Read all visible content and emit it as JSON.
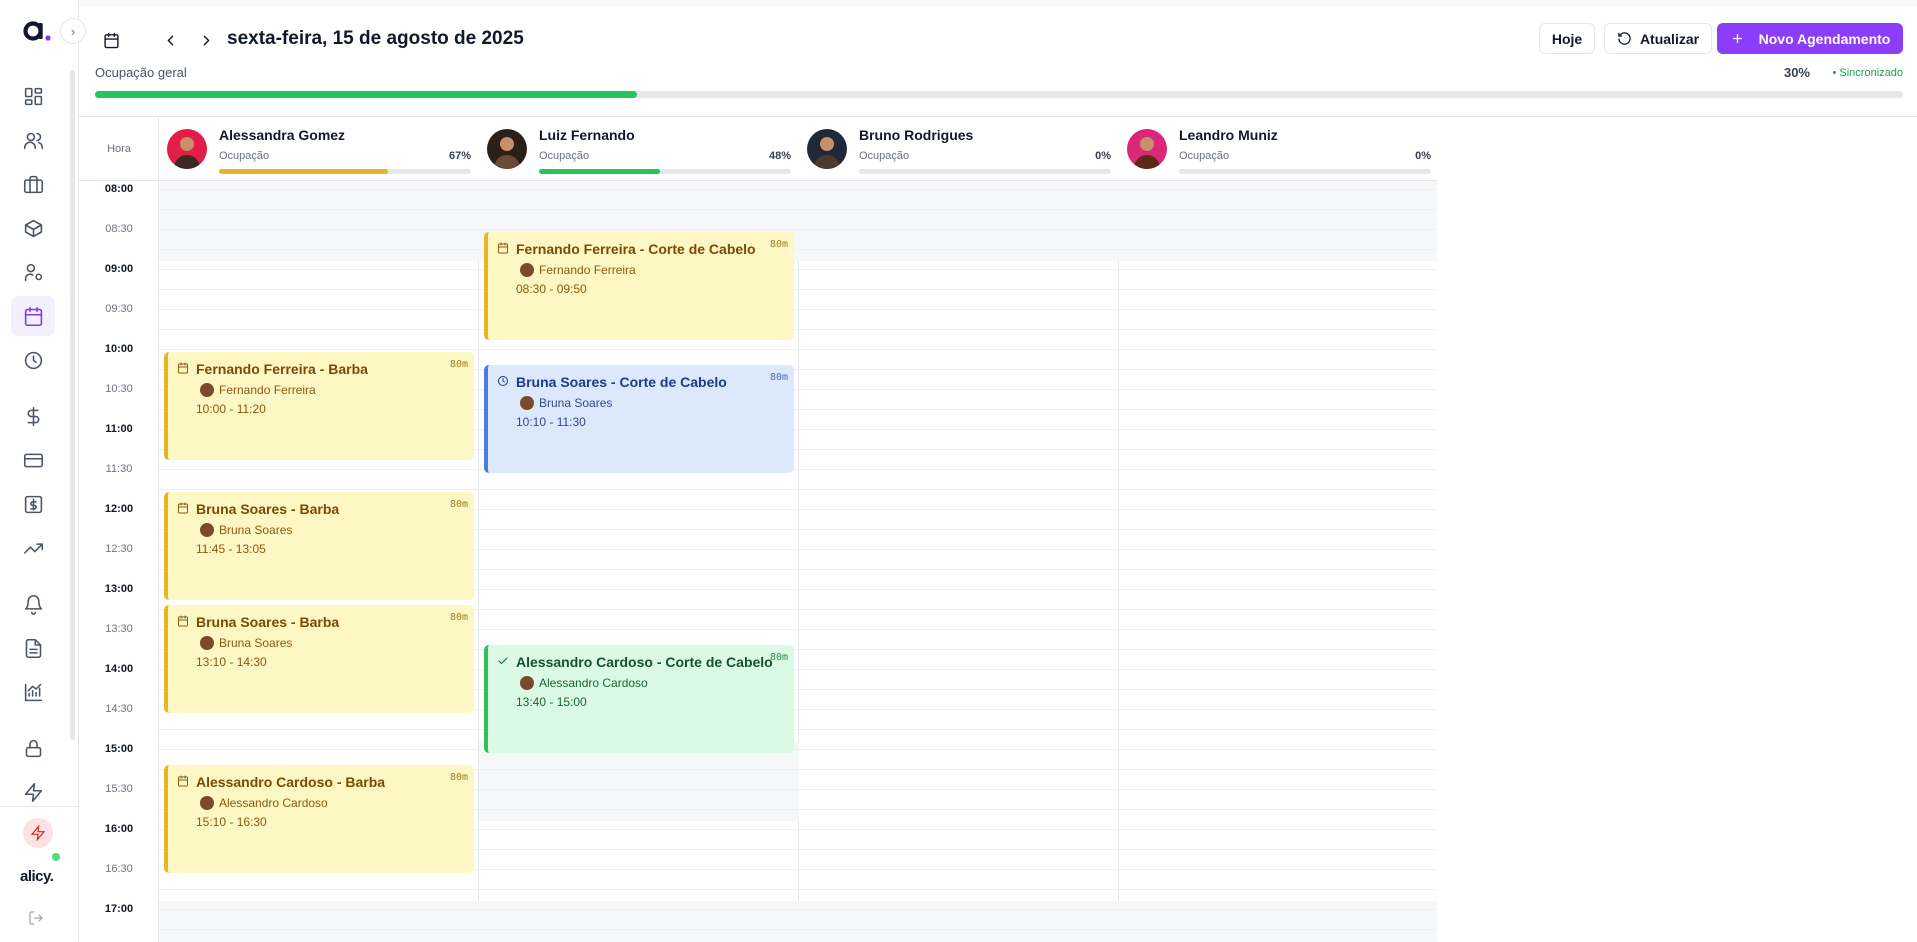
{
  "sidebar": {
    "brand_word": "alicy.",
    "nav_icons": [
      "dashboard-icon",
      "users-icon",
      "briefcase-icon",
      "package-icon",
      "user-cog-icon",
      "calendar-icon",
      "clock-icon",
      "dollar-icon",
      "credit-card-icon",
      "money-bill-icon",
      "trending-up-icon",
      "bell-icon",
      "document-icon",
      "chart-icon",
      "lock-icon",
      "bolt-icon"
    ],
    "active_item": "calendar-icon"
  },
  "header": {
    "date_title": "sexta-feira, 15 de agosto de 2025",
    "today_label": "Hoje",
    "refresh_label": "Atualizar",
    "new_label": "Novo Agendamento",
    "occupancy_label": "Ocupação geral",
    "occupancy_pct": "30%",
    "occupancy_value": 30,
    "sync_label": "• Sincronizado"
  },
  "grid": {
    "hora_label": "Hora",
    "times": [
      "08:00",
      "08:30",
      "09:00",
      "09:30",
      "10:00",
      "10:30",
      "11:00",
      "11:30",
      "12:00",
      "12:30",
      "13:00",
      "13:30",
      "14:00",
      "14:30",
      "15:00",
      "15:30",
      "16:00",
      "16:30",
      "17:00"
    ],
    "professionals": [
      {
        "name": "Alessandra Gomez",
        "occ_label": "Ocupação",
        "pct": "67%",
        "value": 67,
        "color": "#e5b523"
      },
      {
        "name": "Luiz Fernando",
        "occ_label": "Ocupação",
        "pct": "48%",
        "value": 48,
        "color": "#22c55e"
      },
      {
        "name": "Bruno Rodrigues",
        "occ_label": "Ocupação",
        "pct": "0%",
        "value": 0,
        "color": "#22c55e"
      },
      {
        "name": "Leandro Muniz",
        "occ_label": "Ocupação",
        "pct": "0%",
        "value": 0,
        "color": "#22c55e"
      }
    ]
  },
  "events": [
    {
      "col": 0,
      "title": "Fernando Ferreira - Barba",
      "client": "Fernando Ferreira",
      "time": "10:00 - 11:20",
      "duration": "80m",
      "status": "yellow"
    },
    {
      "col": 0,
      "title": "Bruna Soares - Barba",
      "client": "Bruna Soares",
      "time": "11:45 - 13:05",
      "duration": "80m",
      "status": "yellow"
    },
    {
      "col": 0,
      "title": "Bruna Soares - Barba",
      "client": "Bruna Soares",
      "time": "13:10 - 14:30",
      "duration": "80m",
      "status": "yellow"
    },
    {
      "col": 0,
      "title": "Alessandro Cardoso - Barba",
      "client": "Alessandro Cardoso",
      "time": "15:10 - 16:30",
      "duration": "80m",
      "status": "yellow"
    },
    {
      "col": 1,
      "title": "Fernando Ferreira - Corte de Cabelo",
      "client": "Fernando Ferreira",
      "time": "08:30 - 09:50",
      "duration": "80m",
      "status": "yellow"
    },
    {
      "col": 1,
      "title": "Bruna Soares - Corte de Cabelo",
      "client": "Bruna Soares",
      "time": "10:10 - 11:30",
      "duration": "80m",
      "status": "blue"
    },
    {
      "col": 1,
      "title": "Alessandro Cardoso - Corte de Cabelo",
      "client": "Alessandro Cardoso",
      "time": "13:40 - 15:00",
      "duration": "80m",
      "status": "green"
    }
  ]
}
